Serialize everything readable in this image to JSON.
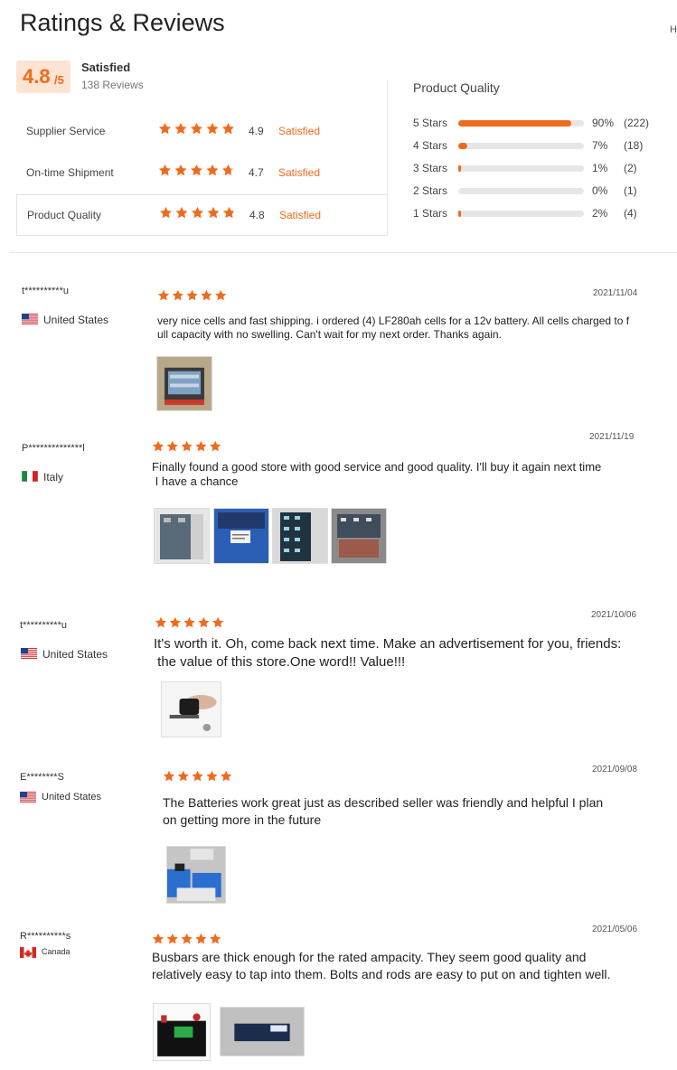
{
  "page": {
    "title": "Ratings & Reviews",
    "edge_text": "H"
  },
  "overall": {
    "score": "4.8",
    "out_of": "/5",
    "label": "Satisfied",
    "reviews_count": "138 Reviews"
  },
  "services": [
    {
      "label": "Supplier Service",
      "score": "4.9",
      "rating": 4.9,
      "status": "Satisfied"
    },
    {
      "label": "On-time Shipment",
      "score": "4.7",
      "rating": 4.7,
      "status": "Satisfied"
    },
    {
      "label": "Product Quality",
      "score": "4.8",
      "rating": 4.8,
      "status": "Satisfied"
    }
  ],
  "quality_breakdown": {
    "title": "Product Quality",
    "rows": [
      {
        "label": "5 Stars",
        "percent": "90%",
        "count": "(222)",
        "fraction": 0.9
      },
      {
        "label": "4 Stars",
        "percent": "7%",
        "count": "(18)",
        "fraction": 0.07
      },
      {
        "label": "3 Stars",
        "percent": "1%",
        "count": "(2)",
        "fraction": 0.01
      },
      {
        "label": "2 Stars",
        "percent": "0%",
        "count": "(1)",
        "fraction": 0.0
      },
      {
        "label": "1 Stars",
        "percent": "2%",
        "count": "(4)",
        "fraction": 0.02
      }
    ]
  },
  "reviews": [
    {
      "user": "t**********u",
      "country": "United States",
      "flag": "us-flag",
      "stars": 5,
      "date": "2021/11/04",
      "text_lines": [
        "very nice cells and fast shipping. i ordered (4) LF280ah cells for a 12v battery. All cells charged to f",
        "ull capacity with no swelling. Can't wait for my next order. Thanks again."
      ],
      "photos": [
        "battery-box-photo"
      ]
    },
    {
      "user": "P**************l",
      "country": "Italy",
      "flag": "italy-flag",
      "stars": 5,
      "date": "2021/11/19",
      "text_lines": [
        "Finally found a good store with good service and good quality. I'll buy it again next time",
        " I have a chance"
      ],
      "photos": [
        "battery-cells-photo",
        "package-label-photo",
        "battery-pack-photo",
        "battery-terminals-photo"
      ]
    },
    {
      "user": "t**********u",
      "country": "United States",
      "flag": "us-flag",
      "stars": 5,
      "date": "2021/10/06",
      "text_lines": [
        "It's worth it. Oh, come back next time. Make an advertisement for you, friends:",
        " the value of this store.One word!! Value!!!"
      ],
      "photos": [
        "hand-with-device-photo"
      ]
    },
    {
      "user": "E********S",
      "country": "United States",
      "flag": "us-flag",
      "stars": 5,
      "date": "2021/09/08",
      "text_lines": [
        "The Batteries work great just as described seller was friendly and helpful I plan",
        "on getting more in the future"
      ],
      "photos": [
        "blue-cells-photo"
      ]
    },
    {
      "user": "R**********s",
      "country": "Canada",
      "flag": "canada-flag",
      "stars": 5,
      "date": "2021/05/06",
      "text_lines": [
        "Busbars are thick enough for the rated ampacity. They seem good quality and",
        "relatively easy to tap into them. Bolts and rods are easy to put on and tighten well."
      ],
      "photos": [
        "battery-with-display-photo",
        "single-cell-photo"
      ]
    }
  ],
  "colors": {
    "accent": "#f06a1d",
    "score_bg": "#fde3d1",
    "bar_track": "#e6e6e6"
  }
}
